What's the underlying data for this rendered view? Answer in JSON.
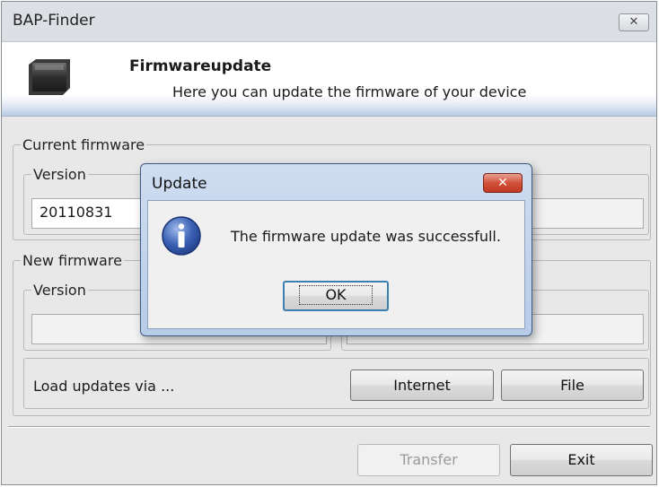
{
  "window": {
    "title": "BAP-Finder",
    "close_glyph": "✕"
  },
  "header": {
    "title": "Firmwareupdate",
    "subtitle": "Here you can update the firmware of your device",
    "icon": "chip-icon"
  },
  "current_firmware": {
    "legend": "Current firmware",
    "version_legend": "Version",
    "version_value": "20110831"
  },
  "new_firmware": {
    "legend": "New firmware",
    "version_legend": "Version",
    "version_value": "",
    "load_label": "Load updates via ...",
    "internet_button": "Internet",
    "file_button": "File"
  },
  "footer": {
    "transfer_button": "Transfer",
    "exit_button": "Exit"
  },
  "dialog": {
    "title": "Update",
    "close_glyph": "✕",
    "icon": "info-icon",
    "message": "The firmware update was successfull.",
    "ok_button": "OK"
  },
  "colors": {
    "dialog_close": "#c9432c",
    "info_icon": "#2a4f9c",
    "header_gradient": "#b9cbe6"
  }
}
